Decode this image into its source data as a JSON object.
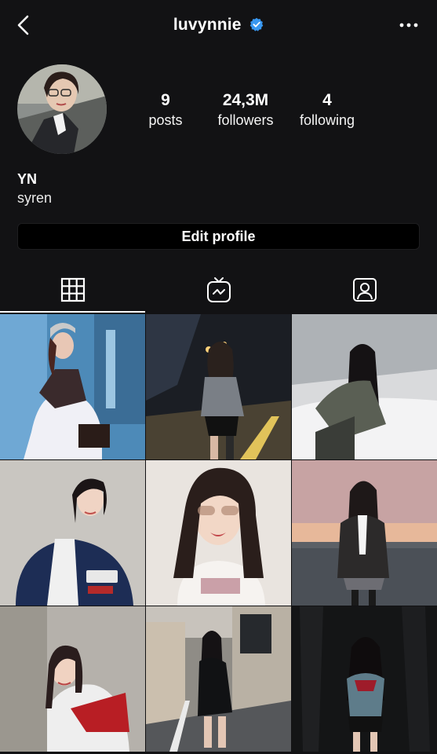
{
  "header": {
    "username": "luvynnie",
    "verified": true,
    "back_icon": "chevron-left-icon",
    "more_icon": "more-horizontal-icon"
  },
  "profile": {
    "stats": {
      "posts_count": "9",
      "posts_label": "posts",
      "followers_count": "24,3M",
      "followers_label": "followers",
      "following_count": "4",
      "following_label": "following"
    },
    "name": "YN",
    "bio": "syren",
    "edit_label": "Edit profile"
  },
  "tabs": [
    {
      "icon": "grid-icon",
      "active": true
    },
    {
      "icon": "igtv-icon",
      "active": false
    },
    {
      "icon": "tagged-icon",
      "active": false
    }
  ],
  "posts": [
    {
      "id": 1,
      "style": "city-blue"
    },
    {
      "id": 2,
      "style": "night-street"
    },
    {
      "id": 3,
      "style": "snow-field"
    },
    {
      "id": 4,
      "style": "studio-jacket"
    },
    {
      "id": 5,
      "style": "selfie-sunglasses"
    },
    {
      "id": 6,
      "style": "sunset-coat"
    },
    {
      "id": 7,
      "style": "room-red-jacket"
    },
    {
      "id": 8,
      "style": "paris-street"
    },
    {
      "id": 9,
      "style": "black-curtain"
    }
  ],
  "colors": {
    "background": "#121214",
    "verified": "#3897f0",
    "button": "#000000"
  }
}
